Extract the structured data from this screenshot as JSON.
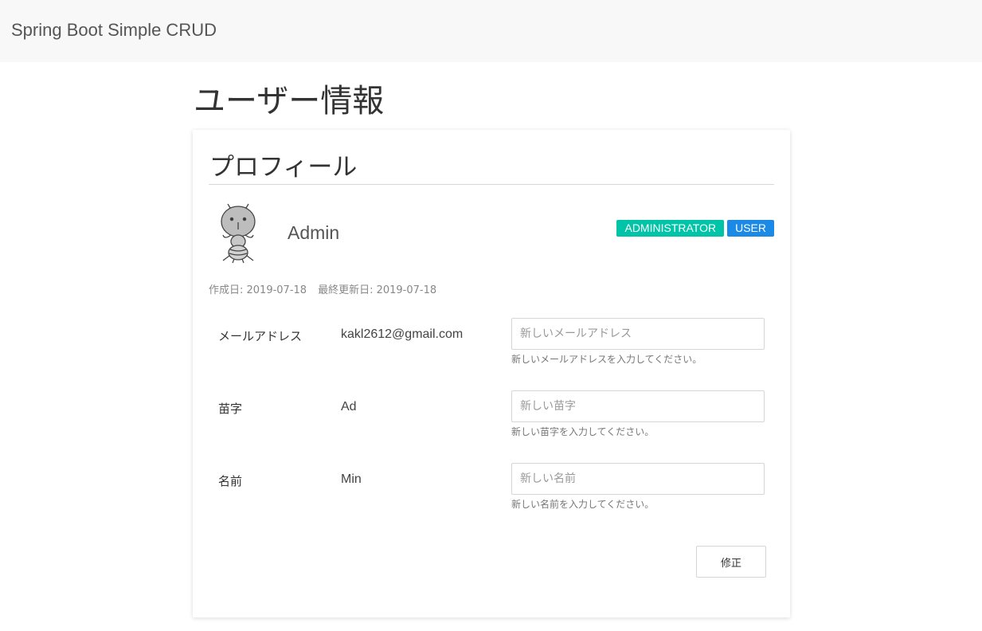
{
  "navbar": {
    "brand": "Spring Boot Simple CRUD"
  },
  "page": {
    "title": "ユーザー情報"
  },
  "card": {
    "title": "プロフィール",
    "avatar_icon": "ant-character-avatar",
    "username": "Admin",
    "roles": [
      {
        "label": "ADMINISTRATOR",
        "color": "#00c4a7"
      },
      {
        "label": "USER",
        "color": "#1a8ae6"
      }
    ],
    "dates": {
      "created": "作成日: 2019-07-18",
      "updated": "最終更新日: 2019-07-18"
    },
    "fields": [
      {
        "label": "メールアドレス",
        "value": "kakl2612@gmail.com",
        "placeholder": "新しいメールアドレス",
        "help": "新しいメールアドレスを入力してください。"
      },
      {
        "label": "苗字",
        "value": "Ad",
        "placeholder": "新しい苗字",
        "help": "新しい苗字を入力してください。"
      },
      {
        "label": "名前",
        "value": "Min",
        "placeholder": "新しい名前",
        "help": "新しい名前を入力してください。"
      }
    ],
    "submit_label": "修正"
  }
}
